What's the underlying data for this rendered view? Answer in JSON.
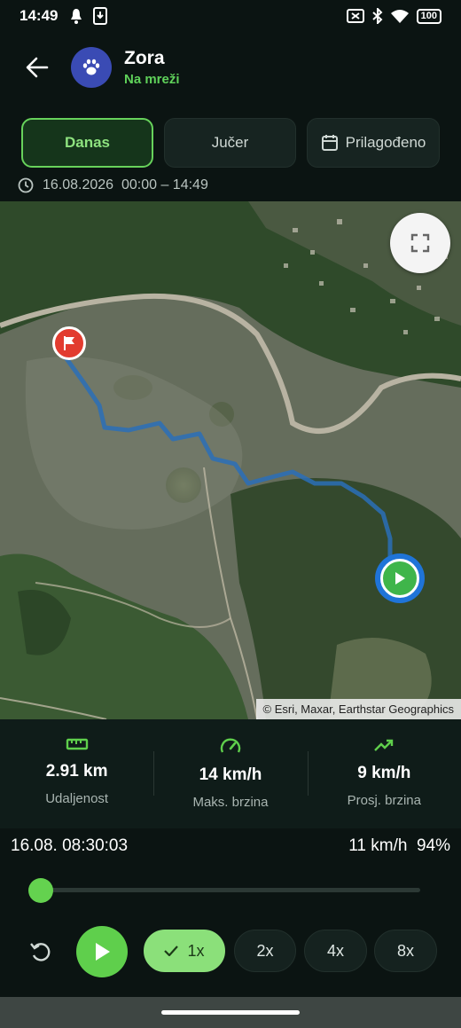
{
  "status_bar": {
    "time": "14:49",
    "battery": "100"
  },
  "header": {
    "pet_name": "Zora",
    "pet_status": "Na mreži"
  },
  "tabs": [
    {
      "label": "Danas",
      "active": true
    },
    {
      "label": "Jučer",
      "active": false
    },
    {
      "label": "Prilagođeno",
      "active": false,
      "icon": "calendar-icon"
    }
  ],
  "date_range": "16.08.2026  00:00 – 14:49",
  "map": {
    "attribution": "© Esri, Maxar, Earthstar Geographics",
    "route_color": "#2a6fb8"
  },
  "stats": [
    {
      "icon": "ruler-icon",
      "value": "2.91 km",
      "label": "Udaljenost"
    },
    {
      "icon": "speedometer-icon",
      "value": "14 km/h",
      "label": "Maks. brzina"
    },
    {
      "icon": "trending-up-icon",
      "value": "9 km/h",
      "label": "Prosj. brzina"
    }
  ],
  "playback": {
    "timestamp": "16.08. 08:30:03",
    "speed_battery": "11 km/h  94%",
    "progress": 0
  },
  "speeds": [
    {
      "label": "1x",
      "selected": true
    },
    {
      "label": "2x",
      "selected": false
    },
    {
      "label": "4x",
      "selected": false
    },
    {
      "label": "8x",
      "selected": false
    }
  ],
  "colors": {
    "accent": "#5fcf4c",
    "background": "#0b1412",
    "avatar": "#3a4bb4",
    "flag": "#e23b2f",
    "current_marker": "#1f74d8"
  }
}
